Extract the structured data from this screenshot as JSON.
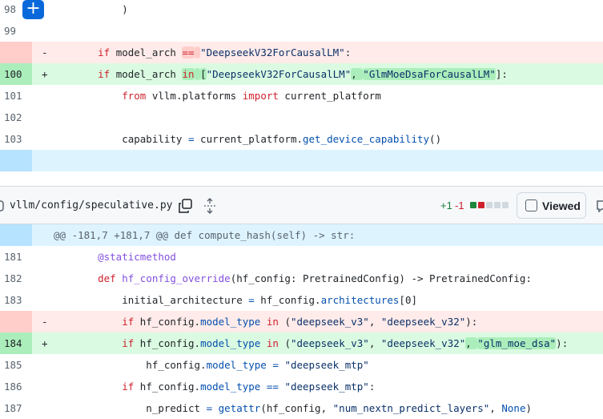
{
  "top_hunk": {
    "rows": [
      {
        "ln": "98",
        "type": "ctx",
        "tokens": [
          [
            "        )",
            ""
          ]
        ]
      },
      {
        "ln": "99",
        "type": "ctx",
        "tokens": []
      },
      {
        "ln": "",
        "type": "del",
        "sign": "-",
        "tokens": [
          [
            "    ",
            ""
          ],
          [
            "if",
            "k"
          ],
          [
            " model_arch ",
            ""
          ],
          [
            "==",
            "k hd"
          ],
          [
            " ",
            "hd"
          ],
          [
            "\"DeepseekV32ForCausalLM\"",
            "s"
          ],
          [
            ":",
            ""
          ]
        ]
      },
      {
        "ln": "100",
        "type": "add",
        "sign": "+",
        "tokens": [
          [
            "    ",
            ""
          ],
          [
            "if",
            "k"
          ],
          [
            " model_arch ",
            ""
          ],
          [
            "in",
            "k ha"
          ],
          [
            " ",
            "ha"
          ],
          [
            "[",
            "ha"
          ],
          [
            "\"DeepseekV32ForCausalLM\"",
            "s"
          ],
          [
            ", ",
            "ha"
          ],
          [
            "\"GlmMoeDsaForCausalLM\"",
            "s ha"
          ],
          [
            "]",
            ""
          ],
          [
            ":",
            ""
          ]
        ]
      },
      {
        "ln": "101",
        "type": "ctx",
        "tokens": [
          [
            "        ",
            ""
          ],
          [
            "from",
            "k"
          ],
          [
            " vllm.platforms ",
            ""
          ],
          [
            "import",
            "k"
          ],
          [
            " current_platform",
            ""
          ]
        ]
      },
      {
        "ln": "102",
        "type": "ctx",
        "tokens": []
      },
      {
        "ln": "103",
        "type": "ctx",
        "tokens": [
          [
            "        capability ",
            ""
          ],
          [
            "=",
            "a"
          ],
          [
            " current_platform.",
            ""
          ],
          [
            "get_device_capability",
            "a"
          ],
          [
            "()",
            ""
          ]
        ]
      },
      {
        "ln": "",
        "type": "hunk",
        "tokens": []
      }
    ]
  },
  "file_header": {
    "filename": "vllm/config/speculative.py",
    "additions": "+1",
    "deletions": "-1",
    "diffstat": [
      "#1f883d",
      "#cf222e",
      "#d1d9e0",
      "#d1d9e0",
      "#d1d9e0"
    ],
    "viewed_label": "Viewed",
    "viewed_checked": false
  },
  "bottom_hunk": {
    "rows": [
      {
        "ln": "",
        "type": "hunk",
        "tokens": [
          [
            "@@ -181,7 +181,7 @@ def compute_hash(self) -> str:",
            ""
          ]
        ]
      },
      {
        "ln": "181",
        "type": "ctx",
        "tokens": [
          [
            "    ",
            ""
          ],
          [
            "@staticmethod",
            "f"
          ]
        ]
      },
      {
        "ln": "182",
        "type": "ctx",
        "tokens": [
          [
            "    ",
            ""
          ],
          [
            "def",
            "k"
          ],
          [
            " ",
            ""
          ],
          [
            "hf_config_override",
            "f"
          ],
          [
            "(hf_config: PretrainedConfig) -> PretrainedConfig:",
            ""
          ]
        ]
      },
      {
        "ln": "183",
        "type": "ctx",
        "tokens": [
          [
            "        initial_architecture ",
            ""
          ],
          [
            "=",
            "a"
          ],
          [
            " hf_config.",
            ""
          ],
          [
            "architectures",
            "a"
          ],
          [
            "[0]",
            ""
          ]
        ]
      },
      {
        "ln": "",
        "type": "del",
        "sign": "-",
        "tokens": [
          [
            "        ",
            ""
          ],
          [
            "if",
            "k"
          ],
          [
            " hf_config.",
            ""
          ],
          [
            "model_type",
            "a"
          ],
          [
            " ",
            ""
          ],
          [
            "in",
            "k"
          ],
          [
            " (",
            ""
          ],
          [
            "\"deepseek_v3\"",
            "s"
          ],
          [
            ", ",
            ""
          ],
          [
            "\"deepseek_v32\"",
            "s"
          ],
          [
            "):",
            ""
          ]
        ]
      },
      {
        "ln": "184",
        "type": "add",
        "sign": "+",
        "tokens": [
          [
            "        ",
            ""
          ],
          [
            "if",
            "k"
          ],
          [
            " hf_config.",
            ""
          ],
          [
            "model_type",
            "a"
          ],
          [
            " ",
            ""
          ],
          [
            "in",
            "k"
          ],
          [
            " (",
            ""
          ],
          [
            "\"deepseek_v3\"",
            "s"
          ],
          [
            ", ",
            ""
          ],
          [
            "\"deepseek_v32\"",
            "s"
          ],
          [
            ", ",
            "ha"
          ],
          [
            "\"glm_moe_dsa\"",
            "s ha"
          ],
          [
            "):",
            ""
          ]
        ]
      },
      {
        "ln": "185",
        "type": "ctx",
        "tokens": [
          [
            "            hf_config.",
            ""
          ],
          [
            "model_type",
            "a"
          ],
          [
            " ",
            ""
          ],
          [
            "=",
            "a"
          ],
          [
            " ",
            ""
          ],
          [
            "\"deepseek_mtp\"",
            "s"
          ]
        ]
      },
      {
        "ln": "186",
        "type": "ctx",
        "tokens": [
          [
            "        ",
            ""
          ],
          [
            "if",
            "k"
          ],
          [
            " hf_config.",
            ""
          ],
          [
            "model_type",
            "a"
          ],
          [
            " ",
            ""
          ],
          [
            "==",
            "a"
          ],
          [
            " ",
            ""
          ],
          [
            "\"deepseek_mtp\"",
            "s"
          ],
          [
            ":",
            ""
          ]
        ]
      },
      {
        "ln": "187",
        "type": "ctx",
        "tokens": [
          [
            "            n_predict ",
            ""
          ],
          [
            "=",
            "a"
          ],
          [
            " ",
            ""
          ],
          [
            "getattr",
            "a"
          ],
          [
            "(hf_config, ",
            ""
          ],
          [
            "\"num_nextn_predict_layers\"",
            "s"
          ],
          [
            ", ",
            ""
          ],
          [
            "None",
            "a"
          ],
          [
            ")",
            ""
          ]
        ]
      }
    ]
  }
}
